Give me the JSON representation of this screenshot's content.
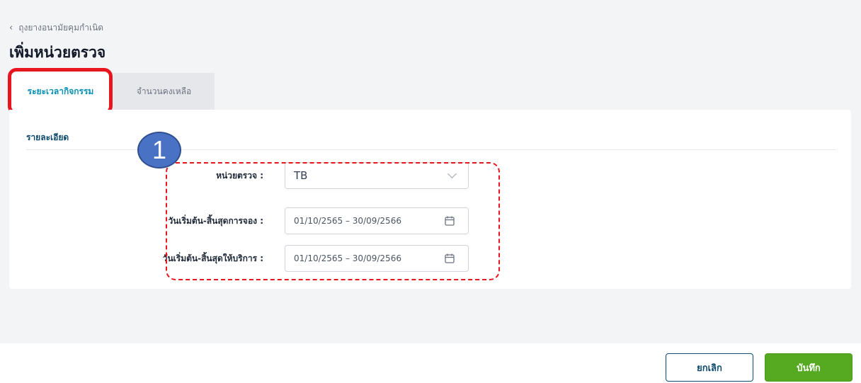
{
  "header": {
    "breadcrumb": "ถุงยางอนามัยคุมกำเนิด",
    "title": "เพิ่มหน่วยตรวจ"
  },
  "tabs": [
    {
      "label": "ระยะเวลากิจกรรม",
      "active": true
    },
    {
      "label": "จำนวนคงเหลือ",
      "active": false
    }
  ],
  "section": {
    "title": "รายละเอียด"
  },
  "form": {
    "unit": {
      "label": "หน่วยตรวจ :",
      "value": "TB"
    },
    "booking_period": {
      "label": "วันเริ่มต้น-สิ้นสุดการจอง :",
      "value": "01/10/2565 – 30/09/2566"
    },
    "service_period": {
      "label": "วันเริ่มต้น-สิ้นสุดให้บริการ :",
      "value": "01/10/2565 – 30/09/2566"
    }
  },
  "annotation": {
    "step_number": "1",
    "highlight_color": "#e8141e"
  },
  "footer": {
    "cancel_label": "ยกเลิก",
    "save_label": "บันทึก"
  },
  "colors": {
    "accent": "#0891b2",
    "primary": "#0c4a6e",
    "save": "#55aa22"
  }
}
